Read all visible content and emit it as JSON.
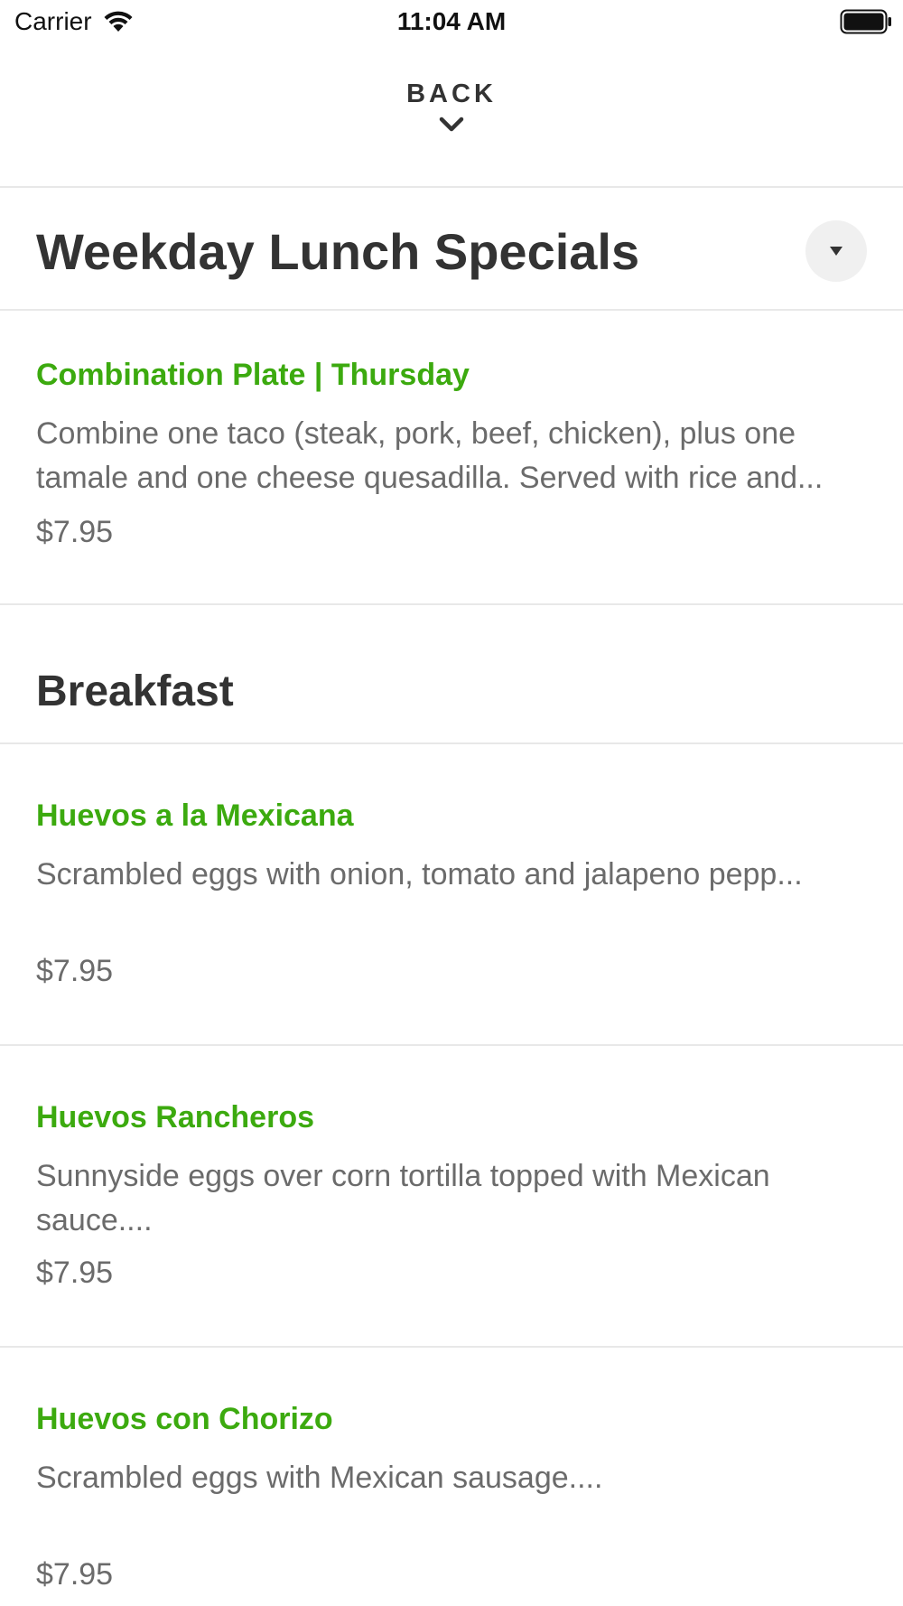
{
  "status_bar": {
    "carrier": "Carrier",
    "time": "11:04 AM",
    "wifi_icon": "wifi-icon",
    "battery_icon": "battery-icon"
  },
  "header": {
    "back_label": "BACK",
    "back_icon": "chevron-down-icon"
  },
  "colors": {
    "item_name": "#3caa0f",
    "heading": "#333333",
    "description": "#6b6b6b",
    "divider": "#e8e8e8",
    "collapse_button_bg": "#f0f0f0"
  },
  "categories": [
    {
      "title": "Weekday Lunch Specials",
      "collapse_icon": "caret-down-icon",
      "items": [
        {
          "name": "Combination Plate | Thursday",
          "description": "Combine one taco (steak, pork, beef, chicken), plus one tamale and one cheese quesadilla. Served with rice and...",
          "price": "$7.95"
        }
      ]
    },
    {
      "title": "Breakfast",
      "items": [
        {
          "name": "Huevos a la Mexicana",
          "description": "Scrambled eggs with onion, tomato and jalapeno pepp...",
          "price": "$7.95"
        },
        {
          "name": "Huevos Rancheros",
          "description": "Sunnyside eggs over corn tortilla topped with Mexican sauce....",
          "price": "$7.95"
        },
        {
          "name": "Huevos con Chorizo",
          "description": "Scrambled eggs with Mexican sausage....",
          "price": "$7.95"
        }
      ]
    }
  ]
}
